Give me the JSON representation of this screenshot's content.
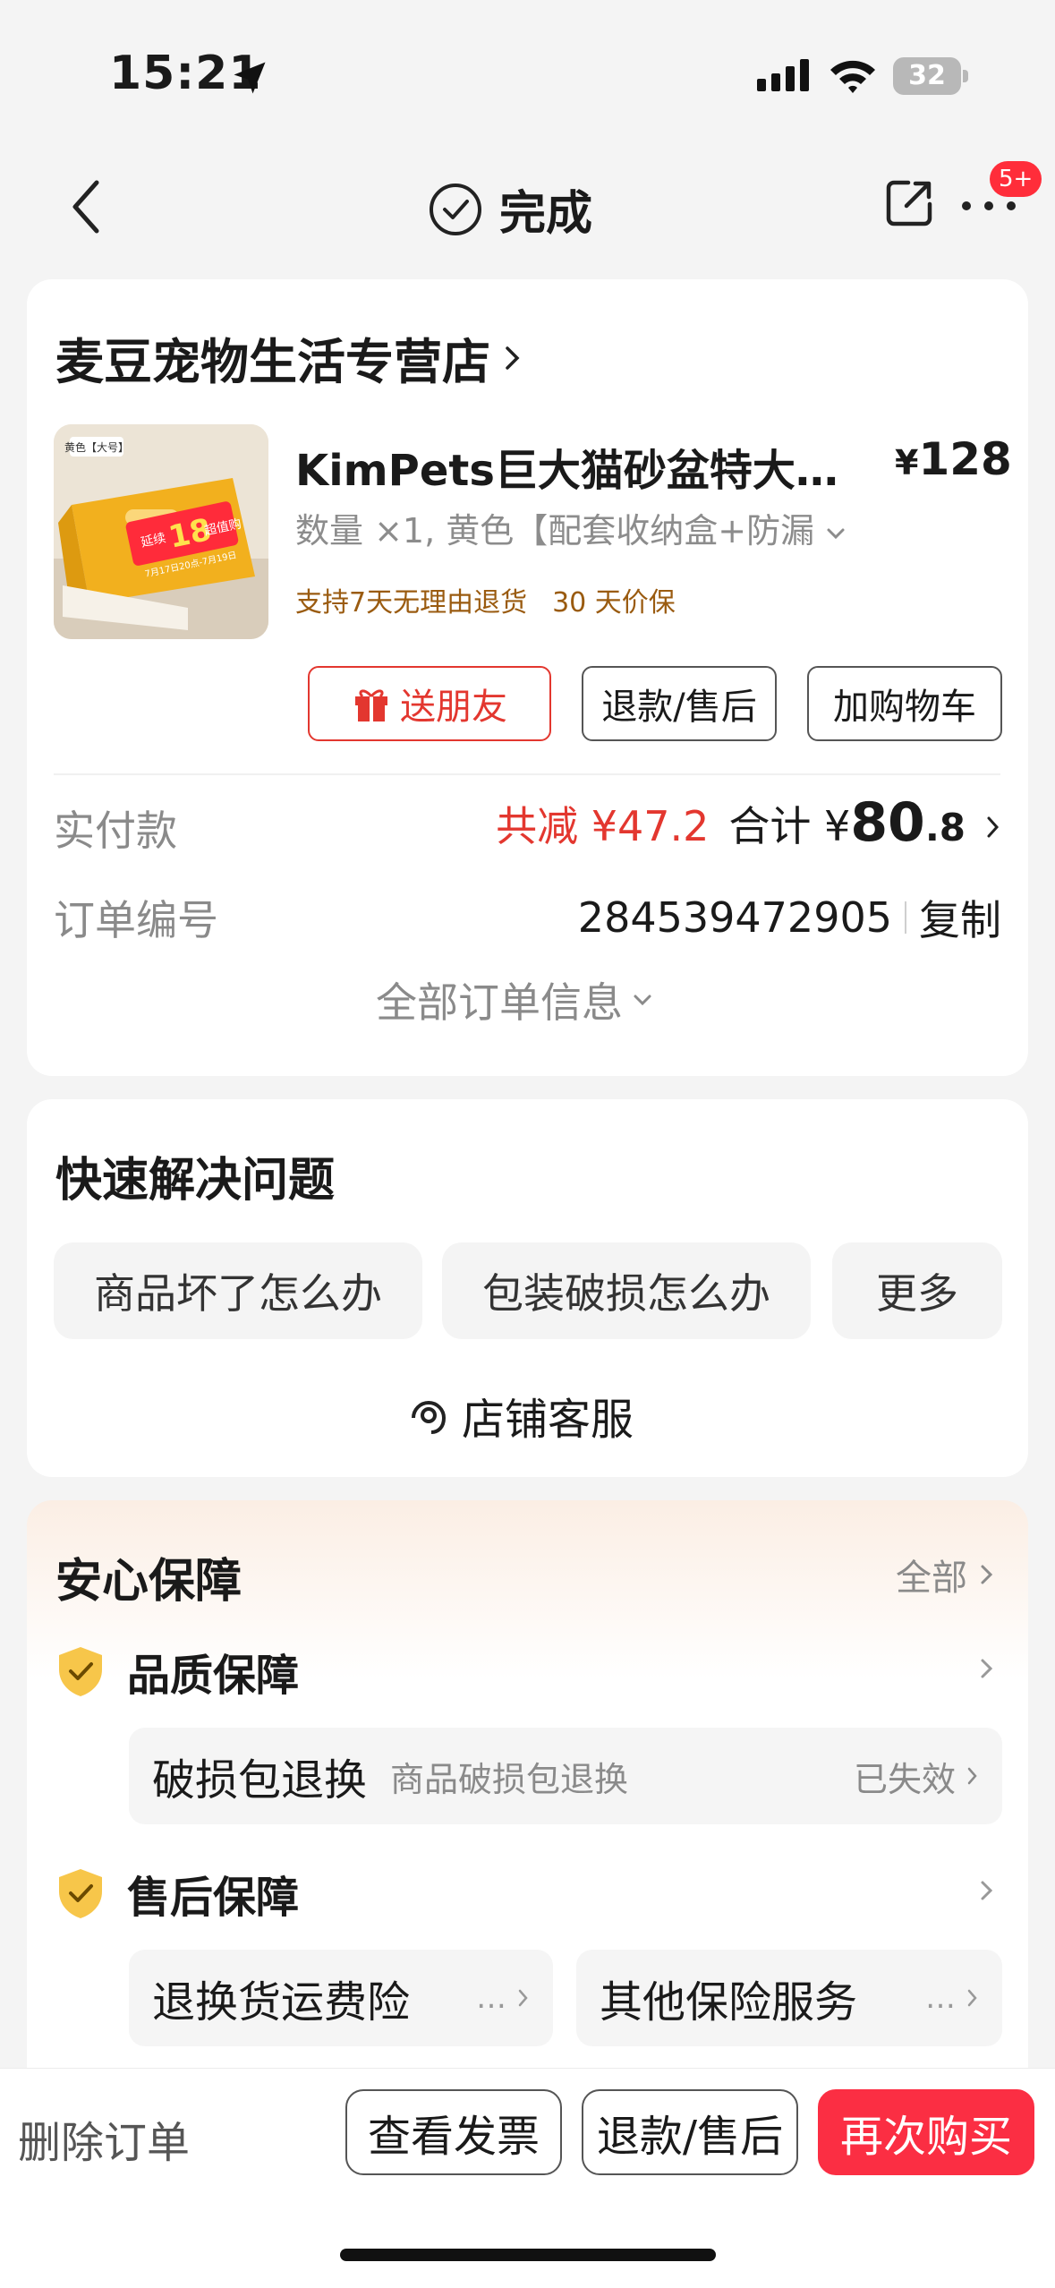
{
  "status_bar": {
    "time": "15:21",
    "battery": "32"
  },
  "nav": {
    "title": "完成",
    "badge": "5+"
  },
  "order": {
    "shop_name": "麦豆宠物生活专营店",
    "product": {
      "title": "KimPets巨大猫砂盆特大…",
      "price_symbol": "¥",
      "price": "128",
      "spec": "数量 ×1, 黄色【配套收纳盒+防漏",
      "promises": [
        "支持7天无理由退货",
        "30 天价保"
      ],
      "thumb": {
        "tag": "黄色【大号】",
        "badge_line1": "延续",
        "badge_big": "18",
        "badge_line2": "超值购",
        "dates": "7月17日20点-7月19日"
      }
    },
    "actions": {
      "gift": "送朋友",
      "refund": "退款/售后",
      "cart": "加购物车"
    },
    "payment": {
      "label": "实付款",
      "reduce_label": "共减",
      "reduce_amount": "¥47.2",
      "total_label": "合计",
      "total_symbol": "¥",
      "total_int": "80",
      "total_dec": ".8"
    },
    "order_no": {
      "label": "订单编号",
      "value": "284539472905",
      "copy": "复制"
    },
    "all_info": "全部订单信息"
  },
  "quick": {
    "title": "快速解决问题",
    "pills": [
      "商品坏了怎么办",
      "包装破损怎么办",
      "更多"
    ],
    "service": "店铺客服"
  },
  "guarantee": {
    "title": "安心保障",
    "all": "全部",
    "quality": {
      "label": "品质保障",
      "item": {
        "name": "破损包退换",
        "desc": "商品破损包退换",
        "status": "已失效"
      }
    },
    "after_sale": {
      "label": "售后保障",
      "items": [
        {
          "name": "退换货运费险",
          "more": "…"
        },
        {
          "name": "其他保险服务",
          "more": "…"
        }
      ]
    }
  },
  "bottom": {
    "delete": "删除订单",
    "invoice": "查看发票",
    "refund": "退款/售后",
    "rebuy": "再次购买"
  },
  "colors": {
    "accent_red": "#e3372f",
    "rebuy_red": "#fb2e43",
    "promise_brown": "#9a5b10"
  }
}
